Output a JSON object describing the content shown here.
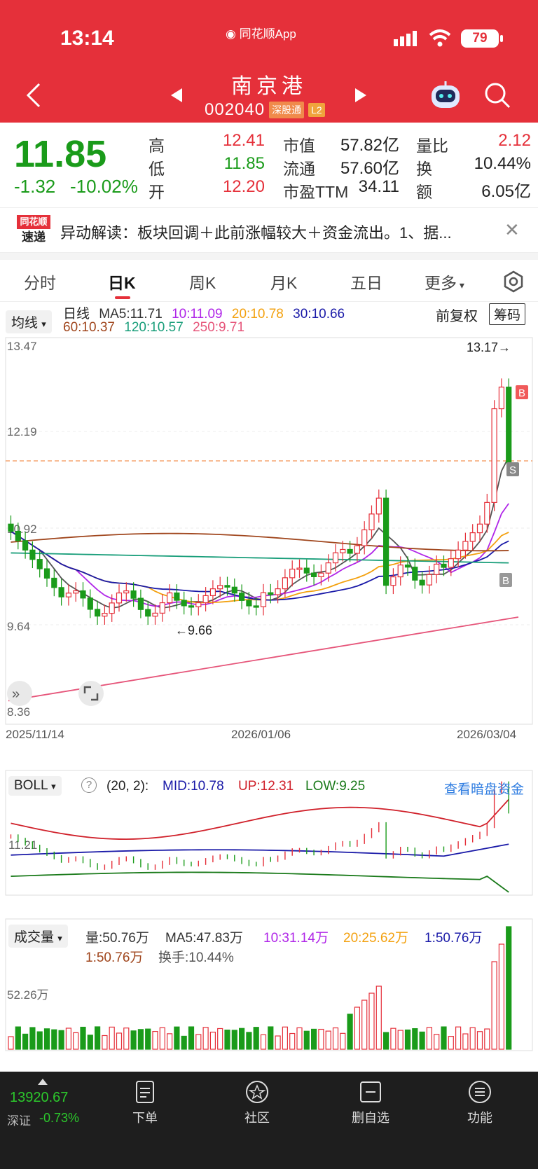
{
  "status": {
    "time": "13:14",
    "app_label": "同花顺App",
    "battery": "79"
  },
  "stock": {
    "name": "南京港",
    "code": "002040",
    "tag1": "深股通",
    "tag2": "L2"
  },
  "quote": {
    "price": "11.85",
    "change": "-1.32",
    "change_pct": "-10.02%",
    "high_label": "高",
    "high": "12.41",
    "low_label": "低",
    "low": "11.85",
    "open_label": "开",
    "open": "12.20",
    "mcap_label": "市值",
    "mcap": "57.82亿",
    "float_label": "流通",
    "float": "57.60亿",
    "pe_label": "市盈TTM",
    "pe": "34.11",
    "vr_label": "量比",
    "vr": "2.12",
    "turnover_label": "换",
    "turnover": "10.44%",
    "amount_label": "额",
    "amount": "6.05亿"
  },
  "news": {
    "logo_top": "同花顺",
    "logo_bottom": "速递",
    "text": "异动解读：板块回调＋此前涨幅较大＋资金流出。1、据..."
  },
  "tabs": [
    "分时",
    "日K",
    "周K",
    "月K",
    "五日",
    "更多"
  ],
  "ma": {
    "select": "均线",
    "period": "日线",
    "ma5": "MA5:11.71",
    "ma10": "10:11.09",
    "ma20": "20:10.78",
    "ma30": "30:10.66",
    "ma60": "60:10.37",
    "ma120": "120:10.57",
    "ma250": "250:9.71",
    "fqq": "前复权",
    "chouma": "筹码"
  },
  "kline": {
    "y_top": "13.47",
    "y_mid1": "12.19",
    "y_mid2": "10.92",
    "y_low": "9.64",
    "y_bottom": "8.36",
    "high_note": "13.17→",
    "low_note": "←9.66",
    "dates": [
      "2025/11/14",
      "2026/01/06",
      "2026/03/04"
    ],
    "markers": [
      "B",
      "S",
      "B"
    ]
  },
  "boll": {
    "select": "BOLL",
    "params": "(20, 2):",
    "mid": "MID:10.78",
    "up": "UP:12.31",
    "low": "LOW:9.25",
    "link": "查看暗盘资金",
    "axis": "11.21"
  },
  "volume": {
    "select": "成交量",
    "vol": "量:50.76万",
    "ma5": "MA5:47.83万",
    "ma10": "10:31.14万",
    "ma20": "20:25.62万",
    "m1": "1:50.76万",
    "m2": "1:50.76万",
    "turnover": "换手:10.44%",
    "axis": "52.26万"
  },
  "footer": {
    "index_value": "13920.67",
    "index_name": "深证",
    "index_chg": "-0.73%",
    "items": [
      "下单",
      "社区",
      "删自选",
      "功能"
    ]
  },
  "colors": {
    "red": "#e5303a",
    "green": "#1a9b1a"
  },
  "chart_data": {
    "type": "candlestick",
    "ylim": [
      8.36,
      13.47
    ],
    "last": {
      "open": 12.2,
      "high": 12.41,
      "low": 11.85,
      "close": 11.85
    },
    "period_high": 13.17,
    "period_low": 9.66
  }
}
